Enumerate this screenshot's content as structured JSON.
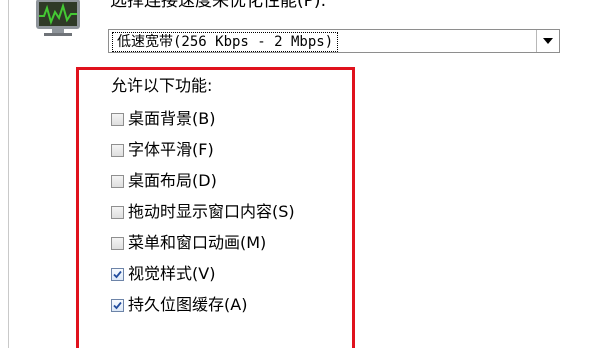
{
  "performance": {
    "label": "选择连接速度来优化性能(P):",
    "speed_value": "低速宽带(256 Kbps - 2 Mbps)"
  },
  "features": {
    "header": "允许以下功能:",
    "items": [
      {
        "label": "桌面背景(B)",
        "checked": false
      },
      {
        "label": "字体平滑(F)",
        "checked": false
      },
      {
        "label": "桌面布局(D)",
        "checked": false
      },
      {
        "label": "拖动时显示窗口内容(S)",
        "checked": false
      },
      {
        "label": "菜单和窗口动画(M)",
        "checked": false
      },
      {
        "label": "视觉样式(V)",
        "checked": true
      },
      {
        "label": "持久位图缓存(A)",
        "checked": true
      }
    ]
  },
  "icons": {
    "monitor": "performance-monitor-icon",
    "dropdown": "chevron-down-icon",
    "check": "checkmark-icon"
  },
  "colors": {
    "highlight_border": "#e0121d",
    "checkmark": "#234d9e",
    "monitor_screen": "#2f3a27",
    "monitor_graph": "#44c933"
  }
}
